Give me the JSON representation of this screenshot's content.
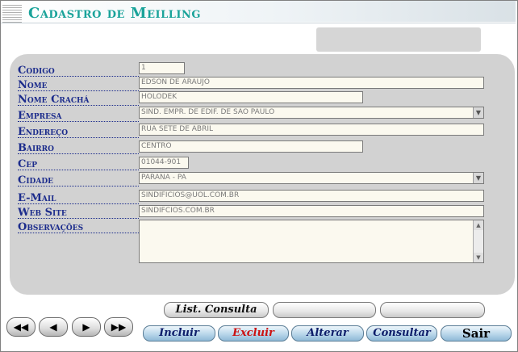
{
  "window": {
    "title": "Cadastro de Meilling"
  },
  "form": {
    "codigo": {
      "label": "Codigo",
      "value": "1"
    },
    "nome": {
      "label": "Nome",
      "value": "EDSON DE ARAUJO"
    },
    "nome_cracha": {
      "label": "Nome Crachá",
      "value": "HOLODEK"
    },
    "empresa": {
      "label": "Empresa",
      "value": "SIND. EMPR. DE EDIF. DE SAO PAULO"
    },
    "endereco": {
      "label": "Endereço",
      "value": "RUA SETE DE ABRIL"
    },
    "bairro": {
      "label": "Bairro",
      "value": "CENTRO"
    },
    "cep": {
      "label": "Cep",
      "value": "01044-901"
    },
    "cidade": {
      "label": "Cidade",
      "value": "PARANA  -  PA"
    },
    "email": {
      "label": "E-Mail",
      "value": "SINDIFICIOS@UOL.COM.BR"
    },
    "website": {
      "label": "Web Site",
      "value": "SINDIFCIOS.COM.BR"
    },
    "observacoes": {
      "label": "Observações",
      "value": ""
    }
  },
  "buttons": {
    "list_consulta": "List. Consulta",
    "incluir": "Incluir",
    "excluir": "Excluir",
    "alterar": "Alterar",
    "consultar": "Consultar",
    "sair": "Sair"
  },
  "nav": {
    "first": "◀◀",
    "prev": "◀",
    "next": "▶",
    "last": "▶▶"
  },
  "icons": {
    "combo_arrow": "▼",
    "scroll_up": "▲",
    "scroll_down": "▼"
  },
  "colors": {
    "title": "#1aa39a",
    "label": "#1c2c8c",
    "excluir": "#cc1111"
  }
}
